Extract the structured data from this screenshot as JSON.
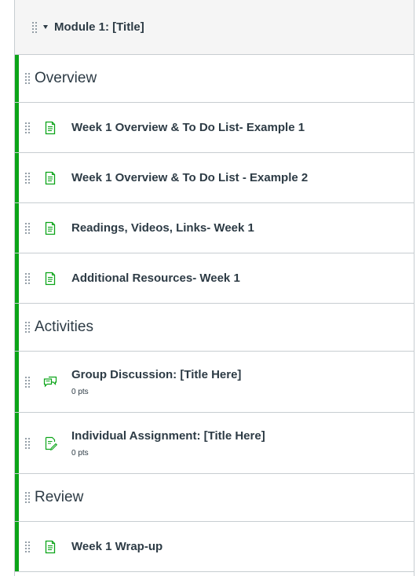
{
  "module": {
    "title": "Module 1: [Title]",
    "accent_color": "#0ba418"
  },
  "sections": [
    {
      "header": "Overview",
      "items": [
        {
          "title": "Week 1 Overview & To Do List- Example 1",
          "icon": "page-icon"
        },
        {
          "title": "Week 1 Overview & To Do List - Example 2",
          "icon": "page-icon"
        },
        {
          "title": "Readings, Videos, Links- Week 1",
          "icon": "page-icon"
        },
        {
          "title": "Additional Resources- Week 1",
          "icon": "page-icon"
        }
      ]
    },
    {
      "header": "Activities",
      "items": [
        {
          "title": "Group Discussion: [Title Here]",
          "points": "0 pts",
          "icon": "discussion-icon"
        },
        {
          "title": "Individual Assignment: [Title Here]",
          "points": "0 pts",
          "icon": "assignment-icon"
        }
      ]
    },
    {
      "header": "Review",
      "items": [
        {
          "title": "Week 1 Wrap-up",
          "icon": "page-icon"
        }
      ]
    }
  ]
}
